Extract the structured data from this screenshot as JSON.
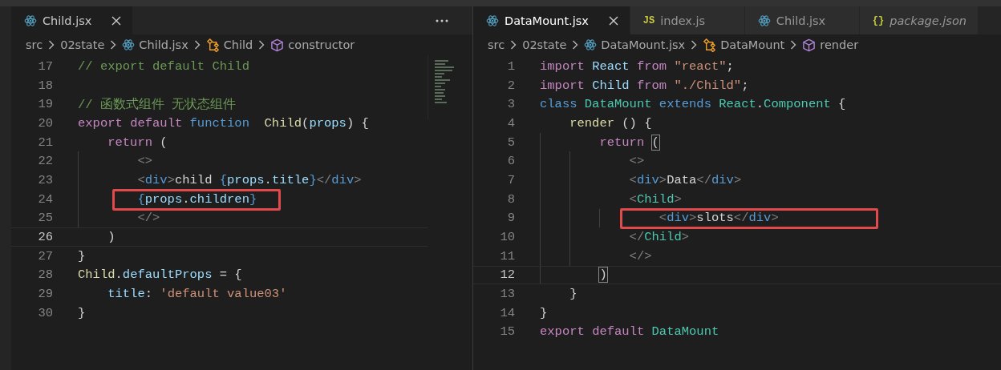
{
  "panes": [
    {
      "actions_menu": true,
      "minimap": true,
      "tabs": [
        {
          "label": "Child.jsx",
          "kind": "react",
          "selected": true,
          "preview": false
        }
      ],
      "breadcrumb": [
        {
          "label": "src"
        },
        {
          "label": "02state"
        },
        {
          "label": "Child.jsx",
          "kind": "react"
        },
        {
          "label": "Child",
          "kind": "class"
        },
        {
          "label": "constructor",
          "kind": "method"
        }
      ],
      "lines": [
        {
          "number": "17",
          "tokens": [
            {
              "text": "// export default Child",
              "kind": "cm"
            }
          ]
        },
        {
          "number": "18"
        },
        {
          "number": "19",
          "tokens": [
            {
              "text": "// 函数式组件 无状态组件",
              "kind": "cm"
            }
          ]
        },
        {
          "number": "20",
          "tokens": [
            {
              "text": "export ",
              "kind": "kw"
            },
            {
              "text": "default ",
              "kind": "kw"
            },
            {
              "text": "function  ",
              "kind": "st"
            },
            {
              "text": "Child",
              "kind": "fn"
            },
            {
              "text": "(",
              "kind": "p"
            },
            {
              "text": "props",
              "kind": "var"
            },
            {
              "text": ") {",
              "kind": "p"
            }
          ]
        },
        {
          "number": "21",
          "tokens": [
            {
              "text": "    return",
              "kind": "kw"
            },
            {
              "text": " (",
              "kind": "p"
            }
          ]
        },
        {
          "number": "22",
          "tokens": [
            {
              "text": "        <>",
              "kind": "tag"
            }
          ]
        },
        {
          "number": "23",
          "tokens": [
            {
              "text": "        <",
              "kind": "tag"
            },
            {
              "text": "div",
              "kind": "st"
            },
            {
              "text": ">",
              "kind": "tag"
            },
            {
              "text": "child ",
              "kind": "p"
            },
            {
              "text": "{",
              "kind": "jsx"
            },
            {
              "text": "props",
              "kind": "var"
            },
            {
              "text": ".",
              "kind": "p"
            },
            {
              "text": "title",
              "kind": "var"
            },
            {
              "text": "}",
              "kind": "jsx"
            },
            {
              "text": "</",
              "kind": "tag"
            },
            {
              "text": "div",
              "kind": "st"
            },
            {
              "text": ">",
              "kind": "tag"
            }
          ]
        },
        {
          "number": "24",
          "highlight": true,
          "tokens": [
            {
              "text": "        {",
              "kind": "jsx"
            },
            {
              "text": "props",
              "kind": "var"
            },
            {
              "text": ".",
              "kind": "p"
            },
            {
              "text": "children",
              "kind": "var"
            },
            {
              "text": "}",
              "kind": "jsx"
            }
          ]
        },
        {
          "number": "25",
          "tokens": [
            {
              "text": "        </>",
              "kind": "tag"
            }
          ]
        },
        {
          "number": "26",
          "current": true,
          "tokens": [
            {
              "text": "    )",
              "kind": "p"
            }
          ]
        },
        {
          "number": "27",
          "tokens": [
            {
              "text": "}",
              "kind": "p"
            }
          ]
        },
        {
          "number": "28",
          "tokens": [
            {
              "text": "Child",
              "kind": "fn"
            },
            {
              "text": ".",
              "kind": "p"
            },
            {
              "text": "defaultProps",
              "kind": "var"
            },
            {
              "text": " = {",
              "kind": "p"
            }
          ]
        },
        {
          "number": "29",
          "tokens": [
            {
              "text": "    title",
              "kind": "var"
            },
            {
              "text": ": ",
              "kind": "p"
            },
            {
              "text": "'default value03'",
              "kind": "str"
            }
          ]
        },
        {
          "number": "30",
          "tokens": [
            {
              "text": "}",
              "kind": "p"
            }
          ]
        }
      ]
    },
    {
      "tabs": [
        {
          "label": "DataMount.jsx",
          "kind": "react",
          "selected": true,
          "preview": false
        },
        {
          "label": "index.js",
          "kind": "badge",
          "badge": "JS",
          "selected": false,
          "preview": false
        },
        {
          "label": "Child.jsx",
          "kind": "react",
          "selected": false,
          "preview": false
        },
        {
          "label": "package.json",
          "kind": "badge",
          "badge": "{}",
          "selected": false,
          "preview": true
        }
      ],
      "breadcrumb": [
        {
          "label": "src"
        },
        {
          "label": "02state"
        },
        {
          "label": "DataMount.jsx",
          "kind": "react"
        },
        {
          "label": "DataMount",
          "kind": "class"
        },
        {
          "label": "render",
          "kind": "method"
        }
      ],
      "lines": [
        {
          "number": "1",
          "tokens": [
            {
              "text": "import ",
              "kind": "kw"
            },
            {
              "text": "React ",
              "kind": "var"
            },
            {
              "text": "from ",
              "kind": "kw"
            },
            {
              "text": "\"react\"",
              "kind": "str"
            },
            {
              "text": ";",
              "kind": "p"
            }
          ]
        },
        {
          "number": "2",
          "tokens": [
            {
              "text": "import ",
              "kind": "kw"
            },
            {
              "text": "Child ",
              "kind": "var"
            },
            {
              "text": "from ",
              "kind": "kw"
            },
            {
              "text": "\"./Child\"",
              "kind": "str"
            },
            {
              "text": ";",
              "kind": "p"
            }
          ]
        },
        {
          "number": "3",
          "tokens": [
            {
              "text": "class ",
              "kind": "st"
            },
            {
              "text": "DataMount ",
              "kind": "cls"
            },
            {
              "text": "extends ",
              "kind": "st"
            },
            {
              "text": "React",
              "kind": "cls"
            },
            {
              "text": ".",
              "kind": "p"
            },
            {
              "text": "Component",
              "kind": "cls"
            },
            {
              "text": " {",
              "kind": "p"
            }
          ]
        },
        {
          "number": "4",
          "tokens": [
            {
              "text": "    render",
              "kind": "fn"
            },
            {
              "text": " () {",
              "kind": "p"
            }
          ]
        },
        {
          "number": "5",
          "tokens": [
            {
              "text": "        return ",
              "kind": "kw"
            },
            {
              "text": "(",
              "kind": "match"
            }
          ]
        },
        {
          "number": "6",
          "tokens": [
            {
              "text": "            <>",
              "kind": "tag"
            }
          ]
        },
        {
          "number": "7",
          "tokens": [
            {
              "text": "            <",
              "kind": "tag"
            },
            {
              "text": "div",
              "kind": "st"
            },
            {
              "text": ">",
              "kind": "tag"
            },
            {
              "text": "Data",
              "kind": "p"
            },
            {
              "text": "</",
              "kind": "tag"
            },
            {
              "text": "div",
              "kind": "st"
            },
            {
              "text": ">",
              "kind": "tag"
            }
          ]
        },
        {
          "number": "8",
          "tokens": [
            {
              "text": "            <",
              "kind": "tag"
            },
            {
              "text": "Child",
              "kind": "cls"
            },
            {
              "text": ">",
              "kind": "tag"
            }
          ]
        },
        {
          "number": "9",
          "highlight": true,
          "tokens": [
            {
              "text": "                <",
              "kind": "tag"
            },
            {
              "text": "div",
              "kind": "st"
            },
            {
              "text": ">",
              "kind": "tag"
            },
            {
              "text": "slots",
              "kind": "p"
            },
            {
              "text": "</",
              "kind": "tag"
            },
            {
              "text": "div",
              "kind": "st"
            },
            {
              "text": ">",
              "kind": "tag"
            }
          ]
        },
        {
          "number": "10",
          "tokens": [
            {
              "text": "            </",
              "kind": "tag"
            },
            {
              "text": "Child",
              "kind": "cls"
            },
            {
              "text": ">",
              "kind": "tag"
            }
          ]
        },
        {
          "number": "11",
          "tokens": [
            {
              "text": "            </>",
              "kind": "tag"
            }
          ]
        },
        {
          "number": "12",
          "current": true,
          "tokens": [
            {
              "text": "        )",
              "kind": "match"
            }
          ]
        },
        {
          "number": "13",
          "tokens": [
            {
              "text": "    }",
              "kind": "p"
            }
          ]
        },
        {
          "number": "14",
          "tokens": [
            {
              "text": "}",
              "kind": "p"
            }
          ]
        },
        {
          "number": "15",
          "tokens": [
            {
              "text": "export ",
              "kind": "kw"
            },
            {
              "text": "default ",
              "kind": "kw"
            },
            {
              "text": "DataMount",
              "kind": "cls"
            }
          ]
        }
      ]
    }
  ]
}
